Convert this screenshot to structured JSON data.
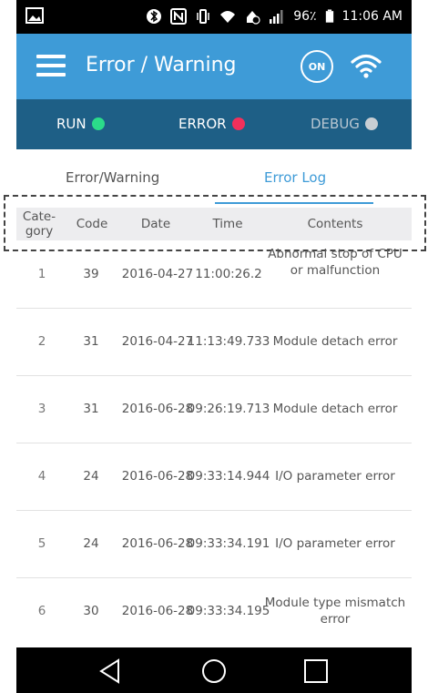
{
  "status_bar": {
    "battery": "96٪",
    "time": "11:06 AM"
  },
  "app_bar": {
    "title": "Error / Warning",
    "on_label": "ON"
  },
  "state_bar": {
    "run": {
      "label": "RUN",
      "color": "#2bdc8a"
    },
    "error": {
      "label": "ERROR",
      "color": "#f2305b"
    },
    "debug": {
      "label": "DEBUG",
      "color": "#c9ced3"
    }
  },
  "tabs": {
    "error_warning": "Error/Warning",
    "error_log": "Error Log",
    "active": "error_log"
  },
  "table": {
    "headers": {
      "category": "Cate-gory",
      "code": "Code",
      "date": "Date",
      "time": "Time",
      "contents": "Contents"
    },
    "rows": [
      {
        "category": "1",
        "code": "39",
        "date": "2016-04-27",
        "time": "11:00:26.2",
        "contents": "Abnormal stop of CPU or malfunction"
      },
      {
        "category": "2",
        "code": "31",
        "date": "2016-04-27",
        "time": "11:13:49.733",
        "contents": "Module detach error"
      },
      {
        "category": "3",
        "code": "31",
        "date": "2016-06-28",
        "time": "09:26:19.713",
        "contents": "Module detach error"
      },
      {
        "category": "4",
        "code": "24",
        "date": "2016-06-28",
        "time": "09:33:14.944",
        "contents": "I/O parameter error"
      },
      {
        "category": "5",
        "code": "24",
        "date": "2016-06-28",
        "time": "09:33:34.191",
        "contents": "I/O parameter error"
      },
      {
        "category": "6",
        "code": "30",
        "date": "2016-06-28",
        "time": "09:33:34.195",
        "contents": "Module type mismatch error"
      }
    ]
  }
}
